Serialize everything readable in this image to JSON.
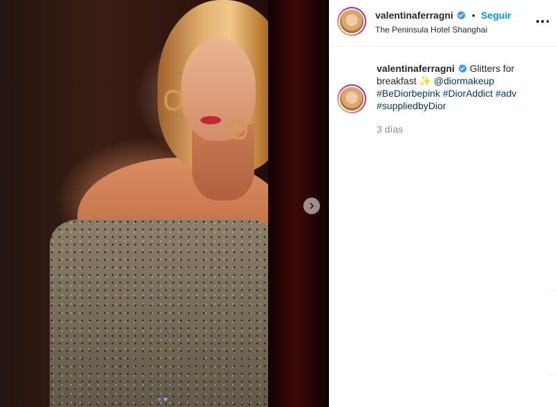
{
  "post": {
    "username": "valentinaferragni",
    "follow_label": "Seguir",
    "separator": "•",
    "location": "The Peninsula Hotel Shanghai",
    "caption": {
      "username": "valentinaferragni",
      "text_before": "Glitters for breakfast",
      "sparkles": "✨",
      "mention": "@diormakeup",
      "hashtags": [
        "#BeDiorbepink",
        "#DiorAddict",
        "#adv",
        "#suppliedbyDior"
      ]
    },
    "time": "3 días"
  },
  "media": {
    "carousel_count": 2,
    "carousel_active_index": 0
  },
  "colors": {
    "follow": "#0095f6",
    "verified": "#3897f0",
    "hashtag": "#00376b",
    "time": "#8e8e8e"
  },
  "icons": {
    "verified": "verified-badge-icon",
    "next": "chevron-right-icon",
    "more": "more-options-icon"
  }
}
